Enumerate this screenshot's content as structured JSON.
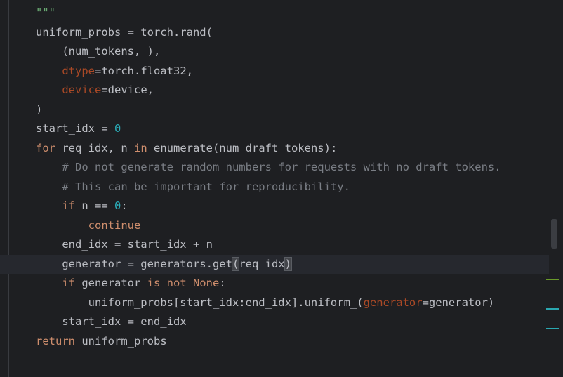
{
  "editor": {
    "lines": [
      {
        "tokens": [
          {
            "t": "\"\"\"",
            "c": "str"
          }
        ]
      },
      {
        "tokens": [
          {
            "t": "uniform_probs = torch.rand(",
            "c": ""
          }
        ]
      },
      {
        "tokens": [
          {
            "t": "    (num_tokens, ),",
            "c": ""
          }
        ]
      },
      {
        "tokens": [
          {
            "t": "    ",
            "c": ""
          },
          {
            "t": "dtype",
            "c": "param"
          },
          {
            "t": "=torch.float32,",
            "c": ""
          }
        ]
      },
      {
        "tokens": [
          {
            "t": "    ",
            "c": ""
          },
          {
            "t": "device",
            "c": "param"
          },
          {
            "t": "=device,",
            "c": ""
          }
        ]
      },
      {
        "tokens": [
          {
            "t": ")",
            "c": ""
          }
        ]
      },
      {
        "tokens": [
          {
            "t": "start_idx = ",
            "c": ""
          },
          {
            "t": "0",
            "c": "num"
          }
        ]
      },
      {
        "tokens": [
          {
            "t": "for",
            "c": "kw"
          },
          {
            "t": " req_idx, n ",
            "c": ""
          },
          {
            "t": "in",
            "c": "kw"
          },
          {
            "t": " enumerate(num_draft_tokens):",
            "c": ""
          }
        ]
      },
      {
        "tokens": [
          {
            "t": "    ",
            "c": ""
          },
          {
            "t": "# Do not generate random numbers for requests with no draft tokens.",
            "c": "cmt"
          }
        ]
      },
      {
        "tokens": [
          {
            "t": "    ",
            "c": ""
          },
          {
            "t": "# This can be important for reproducibility.",
            "c": "cmt"
          }
        ]
      },
      {
        "tokens": [
          {
            "t": "    ",
            "c": ""
          },
          {
            "t": "if",
            "c": "kw"
          },
          {
            "t": " n == ",
            "c": ""
          },
          {
            "t": "0",
            "c": "num"
          },
          {
            "t": ":",
            "c": ""
          }
        ]
      },
      {
        "tokens": [
          {
            "t": "        ",
            "c": ""
          },
          {
            "t": "continue",
            "c": "kw"
          }
        ]
      },
      {
        "tokens": [
          {
            "t": "    end_idx = start_idx + n",
            "c": ""
          }
        ]
      },
      {
        "tokens": [
          {
            "t": "    generator = generators.get",
            "c": ""
          },
          {
            "t": "(",
            "c": "brace"
          },
          {
            "t": "req_idx",
            "c": ""
          },
          {
            "t": ")",
            "c": "brace"
          }
        ],
        "current": true
      },
      {
        "tokens": [
          {
            "t": "    ",
            "c": ""
          },
          {
            "t": "if",
            "c": "kw"
          },
          {
            "t": " generator ",
            "c": ""
          },
          {
            "t": "is not None",
            "c": "kw"
          },
          {
            "t": ":",
            "c": ""
          }
        ]
      },
      {
        "tokens": [
          {
            "t": "        uniform_probs[start_idx:end_idx].uniform_(",
            "c": ""
          },
          {
            "t": "generator",
            "c": "param"
          },
          {
            "t": "=generator)",
            "c": ""
          }
        ]
      },
      {
        "tokens": [
          {
            "t": "    start_idx = end_idx",
            "c": ""
          }
        ]
      },
      {
        "tokens": [
          {
            "t": "return",
            "c": "kw"
          },
          {
            "t": " uniform_probs",
            "c": ""
          }
        ]
      }
    ],
    "markers": [
      {
        "color": "#6a9a2a"
      },
      {
        "color": "#2aa7b0"
      },
      {
        "color": "#2aa7b0"
      }
    ]
  }
}
